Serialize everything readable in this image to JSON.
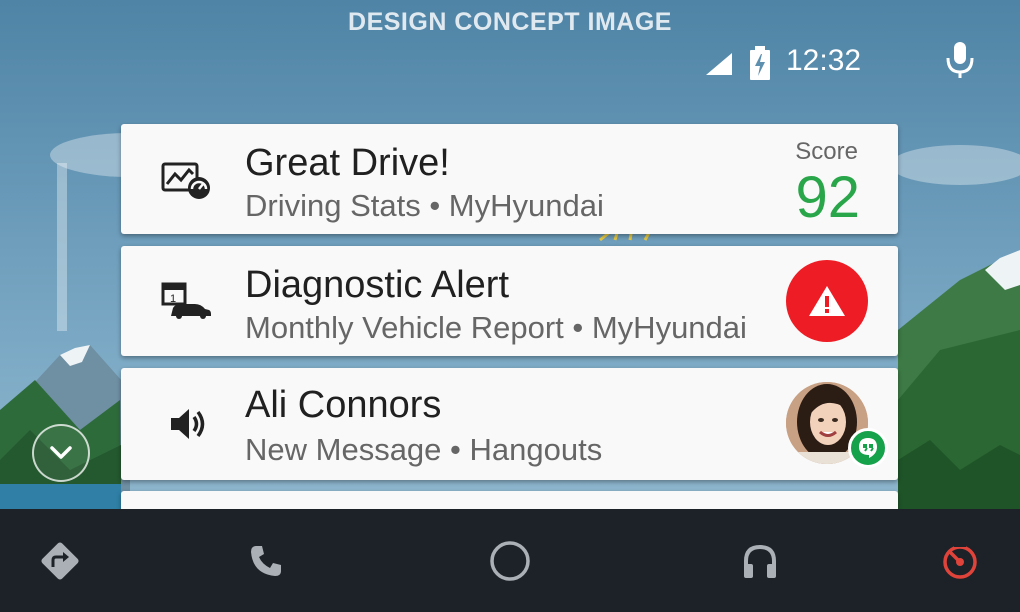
{
  "banner": "DESIGN CONCEPT IMAGE",
  "status": {
    "time": "12:32",
    "icons": [
      "cell-signal-icon",
      "battery-charging-icon",
      "microphone-icon"
    ]
  },
  "cards": [
    {
      "icon": "driving-stats-icon",
      "title": "Great Drive!",
      "subtitle": "Driving Stats • MyHyundai",
      "score_label": "Score",
      "score_value": "92"
    },
    {
      "icon": "calendar-car-icon",
      "title": "Diagnostic Alert",
      "subtitle": "Monthly Vehicle Report • MyHyundai",
      "badge": "warning-icon"
    },
    {
      "icon": "speaker-icon",
      "title": "Ali Connors",
      "subtitle": "New Message • Hangouts",
      "badge": "hangouts-icon"
    }
  ],
  "navbar": {
    "items": [
      "navigation-icon",
      "phone-icon",
      "home-icon",
      "headphones-icon",
      "vehicle-dashboard-icon"
    ]
  },
  "colors": {
    "score": "#2aa64a",
    "alert": "#ee1c24",
    "navbar": "#1c2228",
    "dashboard_accent": "#e0433a"
  }
}
